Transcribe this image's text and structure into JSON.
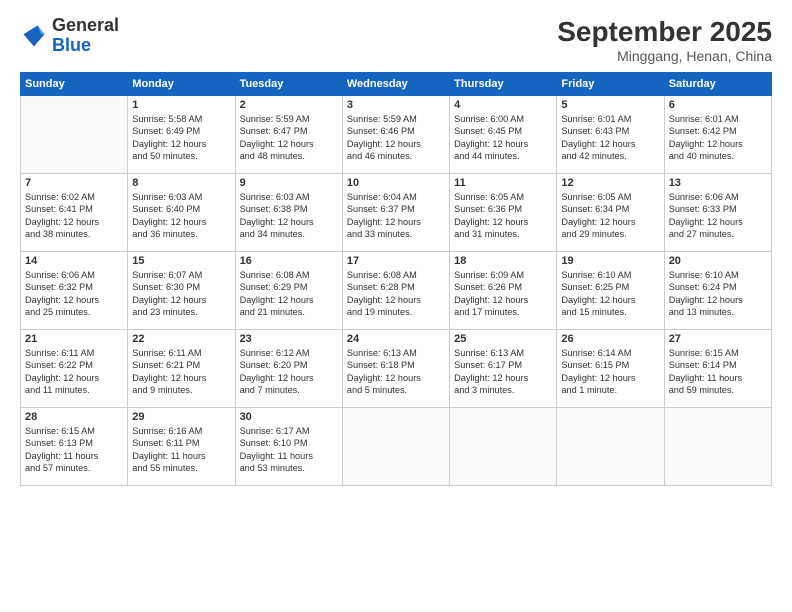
{
  "header": {
    "logo_general": "General",
    "logo_blue": "Blue",
    "month": "September 2025",
    "location": "Minggang, Henan, China"
  },
  "days_of_week": [
    "Sunday",
    "Monday",
    "Tuesday",
    "Wednesday",
    "Thursday",
    "Friday",
    "Saturday"
  ],
  "weeks": [
    [
      {
        "day": "",
        "info": ""
      },
      {
        "day": "1",
        "info": "Sunrise: 5:58 AM\nSunset: 6:49 PM\nDaylight: 12 hours\nand 50 minutes."
      },
      {
        "day": "2",
        "info": "Sunrise: 5:59 AM\nSunset: 6:47 PM\nDaylight: 12 hours\nand 48 minutes."
      },
      {
        "day": "3",
        "info": "Sunrise: 5:59 AM\nSunset: 6:46 PM\nDaylight: 12 hours\nand 46 minutes."
      },
      {
        "day": "4",
        "info": "Sunrise: 6:00 AM\nSunset: 6:45 PM\nDaylight: 12 hours\nand 44 minutes."
      },
      {
        "day": "5",
        "info": "Sunrise: 6:01 AM\nSunset: 6:43 PM\nDaylight: 12 hours\nand 42 minutes."
      },
      {
        "day": "6",
        "info": "Sunrise: 6:01 AM\nSunset: 6:42 PM\nDaylight: 12 hours\nand 40 minutes."
      }
    ],
    [
      {
        "day": "7",
        "info": "Sunrise: 6:02 AM\nSunset: 6:41 PM\nDaylight: 12 hours\nand 38 minutes."
      },
      {
        "day": "8",
        "info": "Sunrise: 6:03 AM\nSunset: 6:40 PM\nDaylight: 12 hours\nand 36 minutes."
      },
      {
        "day": "9",
        "info": "Sunrise: 6:03 AM\nSunset: 6:38 PM\nDaylight: 12 hours\nand 34 minutes."
      },
      {
        "day": "10",
        "info": "Sunrise: 6:04 AM\nSunset: 6:37 PM\nDaylight: 12 hours\nand 33 minutes."
      },
      {
        "day": "11",
        "info": "Sunrise: 6:05 AM\nSunset: 6:36 PM\nDaylight: 12 hours\nand 31 minutes."
      },
      {
        "day": "12",
        "info": "Sunrise: 6:05 AM\nSunset: 6:34 PM\nDaylight: 12 hours\nand 29 minutes."
      },
      {
        "day": "13",
        "info": "Sunrise: 6:06 AM\nSunset: 6:33 PM\nDaylight: 12 hours\nand 27 minutes."
      }
    ],
    [
      {
        "day": "14",
        "info": "Sunrise: 6:06 AM\nSunset: 6:32 PM\nDaylight: 12 hours\nand 25 minutes."
      },
      {
        "day": "15",
        "info": "Sunrise: 6:07 AM\nSunset: 6:30 PM\nDaylight: 12 hours\nand 23 minutes."
      },
      {
        "day": "16",
        "info": "Sunrise: 6:08 AM\nSunset: 6:29 PM\nDaylight: 12 hours\nand 21 minutes."
      },
      {
        "day": "17",
        "info": "Sunrise: 6:08 AM\nSunset: 6:28 PM\nDaylight: 12 hours\nand 19 minutes."
      },
      {
        "day": "18",
        "info": "Sunrise: 6:09 AM\nSunset: 6:26 PM\nDaylight: 12 hours\nand 17 minutes."
      },
      {
        "day": "19",
        "info": "Sunrise: 6:10 AM\nSunset: 6:25 PM\nDaylight: 12 hours\nand 15 minutes."
      },
      {
        "day": "20",
        "info": "Sunrise: 6:10 AM\nSunset: 6:24 PM\nDaylight: 12 hours\nand 13 minutes."
      }
    ],
    [
      {
        "day": "21",
        "info": "Sunrise: 6:11 AM\nSunset: 6:22 PM\nDaylight: 12 hours\nand 11 minutes."
      },
      {
        "day": "22",
        "info": "Sunrise: 6:11 AM\nSunset: 6:21 PM\nDaylight: 12 hours\nand 9 minutes."
      },
      {
        "day": "23",
        "info": "Sunrise: 6:12 AM\nSunset: 6:20 PM\nDaylight: 12 hours\nand 7 minutes."
      },
      {
        "day": "24",
        "info": "Sunrise: 6:13 AM\nSunset: 6:18 PM\nDaylight: 12 hours\nand 5 minutes."
      },
      {
        "day": "25",
        "info": "Sunrise: 6:13 AM\nSunset: 6:17 PM\nDaylight: 12 hours\nand 3 minutes."
      },
      {
        "day": "26",
        "info": "Sunrise: 6:14 AM\nSunset: 6:15 PM\nDaylight: 12 hours\nand 1 minute."
      },
      {
        "day": "27",
        "info": "Sunrise: 6:15 AM\nSunset: 6:14 PM\nDaylight: 11 hours\nand 59 minutes."
      }
    ],
    [
      {
        "day": "28",
        "info": "Sunrise: 6:15 AM\nSunset: 6:13 PM\nDaylight: 11 hours\nand 57 minutes."
      },
      {
        "day": "29",
        "info": "Sunrise: 6:16 AM\nSunset: 6:11 PM\nDaylight: 11 hours\nand 55 minutes."
      },
      {
        "day": "30",
        "info": "Sunrise: 6:17 AM\nSunset: 6:10 PM\nDaylight: 11 hours\nand 53 minutes."
      },
      {
        "day": "",
        "info": ""
      },
      {
        "day": "",
        "info": ""
      },
      {
        "day": "",
        "info": ""
      },
      {
        "day": "",
        "info": ""
      }
    ]
  ]
}
